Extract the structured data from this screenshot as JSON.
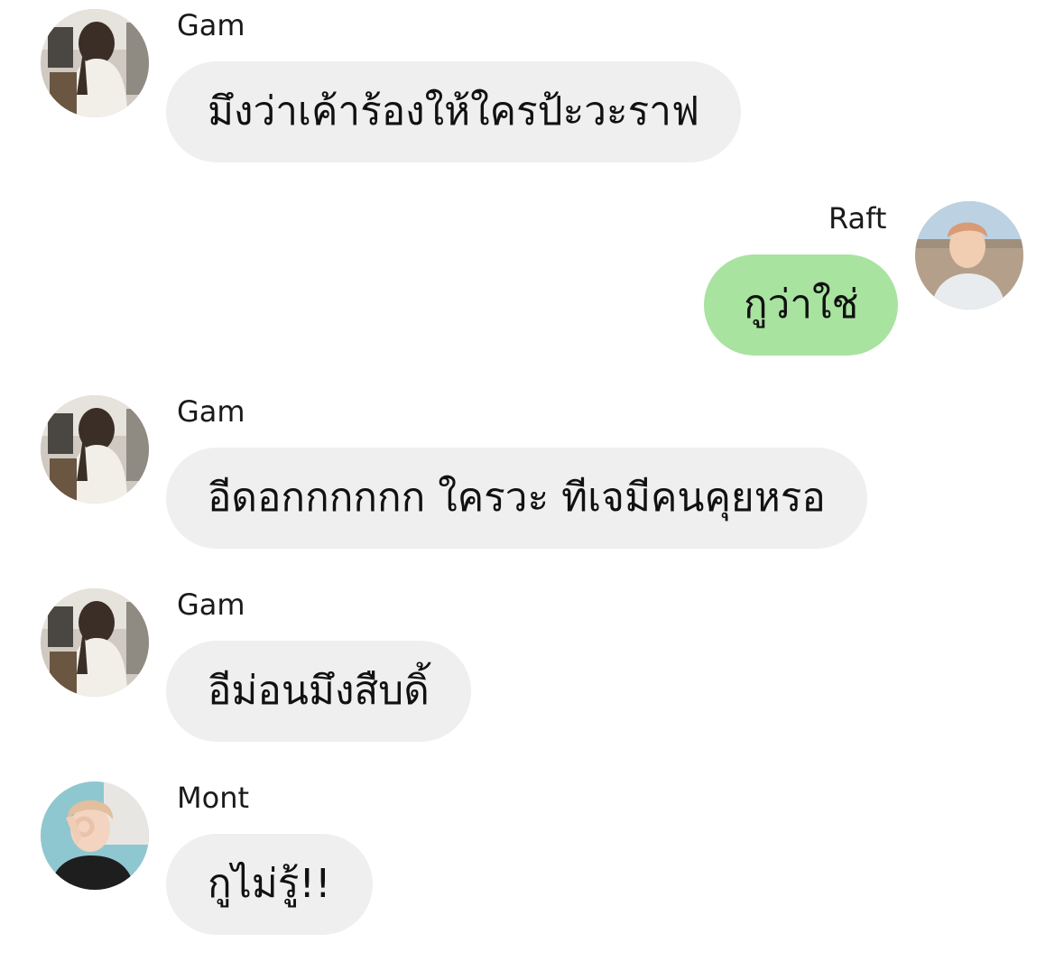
{
  "colors": {
    "incoming_bubble": "#efefef",
    "outgoing_bubble": "#a8e3a0",
    "background": "#ffffff",
    "text": "#111111"
  },
  "messages": [
    {
      "sender": "Gam",
      "avatar_icon": "gam-avatar-photo",
      "text": "มึงว่าเค้าร้องให้ใครป้ะวะราฟ",
      "side": "left"
    },
    {
      "sender": "Raft",
      "avatar_icon": "raft-avatar-photo",
      "text": "กูว่าใช่",
      "side": "right"
    },
    {
      "sender": "Gam",
      "avatar_icon": "gam-avatar-photo",
      "text": "อีดอกกกกกก ใครวะ ทีเจมีคนคุยหรอ",
      "side": "left"
    },
    {
      "sender": "Gam",
      "avatar_icon": "gam-avatar-photo",
      "text": "อีม่อนมึงสืบดิ้",
      "side": "left"
    },
    {
      "sender": "Mont",
      "avatar_icon": "mont-avatar-photo",
      "text": "กูไม่รู้!!",
      "side": "left"
    }
  ]
}
